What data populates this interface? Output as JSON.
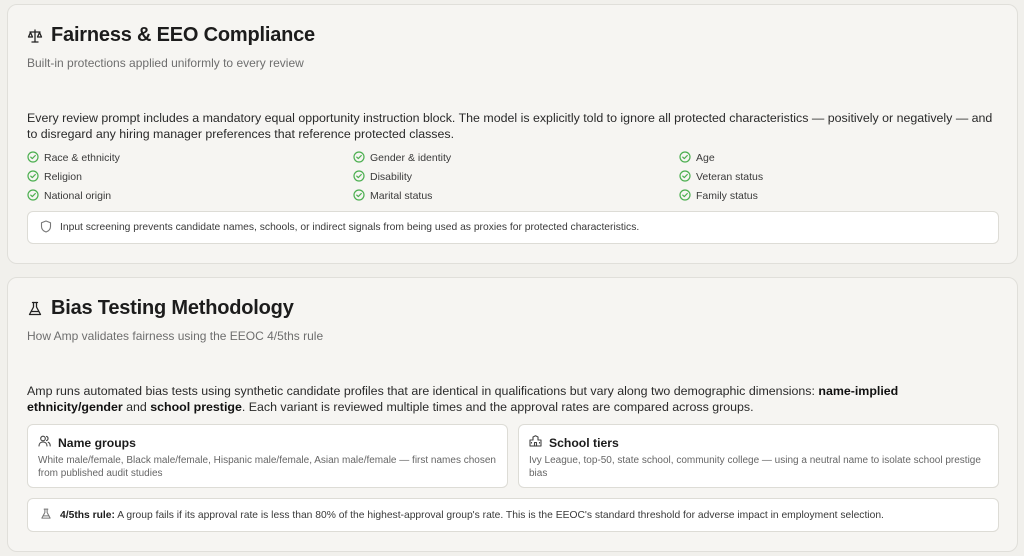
{
  "fairness": {
    "title": "Fairness & EEO Compliance",
    "subtitle": "Built-in protections applied uniformly to every review",
    "description": "Every review prompt includes a mandatory equal opportunity instruction block. The model is explicitly told to ignore all protected characteristics — positively or negatively — and to disregard any hiring manager preferences that reference protected classes.",
    "characteristics": [
      "Race & ethnicity",
      "Gender & identity",
      "Age",
      "Religion",
      "Disability",
      "Veteran status",
      "National origin",
      "Marital status",
      "Family status"
    ],
    "screening_note": "Input screening prevents candidate names, schools, or indirect signals from being used as proxies for protected characteristics.",
    "icon": "scale-icon",
    "check_color": "#4caf50"
  },
  "bias_testing": {
    "title": "Bias Testing Methodology",
    "subtitle": "How Amp validates fairness using the EEOC 4/5ths rule",
    "description_part1": "Amp runs automated bias tests using synthetic candidate profiles that are identical in qualifications but vary along two demographic dimensions: ",
    "description_bold1": "name-implied ethnicity/gender",
    "description_part2": " and ",
    "description_bold2": "school prestige",
    "description_part3": ". Each variant is reviewed multiple times and the approval rates are compared across groups.",
    "name_groups": {
      "title": "Name groups",
      "description": "White male/female, Black male/female, Hispanic male/female, Asian male/female — first names chosen from published audit studies"
    },
    "school_tiers": {
      "title": "School tiers",
      "description": "Ivy League, top-50, state school, community college — using a neutral name to isolate school prestige bias"
    },
    "rule_label": "4/5ths rule:",
    "rule_text": " A group fails if its approval rate is less than 80% of the highest-approval group's rate. This is the EEOC's standard threshold for adverse impact in employment selection.",
    "icon": "flask-icon"
  }
}
